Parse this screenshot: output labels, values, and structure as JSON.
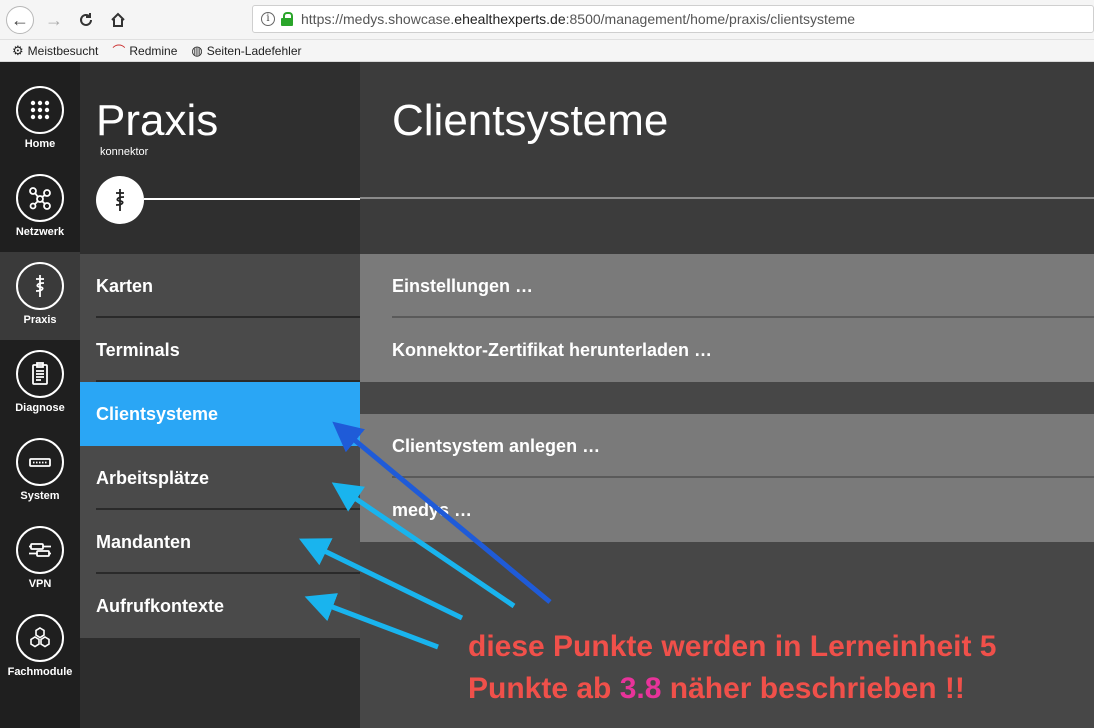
{
  "browser": {
    "url_prefix": "https://medys.showcase.",
    "url_domain": "ehealthexperts.de",
    "url_suffix": ":8500/management/home/praxis/clientsysteme",
    "bookmarks": [
      "Meistbesucht",
      "Redmine",
      "Seiten-Ladefehler"
    ]
  },
  "left_nav": {
    "items": [
      {
        "label": "Home",
        "icon": "grid-icon"
      },
      {
        "label": "Netzwerk",
        "icon": "network-icon"
      },
      {
        "label": "Praxis",
        "icon": "caduceus-icon"
      },
      {
        "label": "Diagnose",
        "icon": "clipboard-icon"
      },
      {
        "label": "System",
        "icon": "device-icon"
      },
      {
        "label": "VPN",
        "icon": "vpn-icon"
      },
      {
        "label": "Fachmodule",
        "icon": "hexagons-icon"
      }
    ],
    "active": "Praxis"
  },
  "sub_panel": {
    "title": "Praxis",
    "subtitle": "konnektor",
    "menu": [
      "Karten",
      "Terminals",
      "Clientsysteme",
      "Arbeitsplätze",
      "Mandanten",
      "Aufrufkontexte"
    ],
    "active": "Clientsysteme"
  },
  "main": {
    "title": "Clientsysteme",
    "actions": [
      "Einstellungen …",
      "Konnektor-Zertifikat herunterladen …"
    ],
    "items": [
      "Clientsystem anlegen …",
      "medys …"
    ]
  },
  "annotation": {
    "line1": "diese Punkte werden in Lerneinheit 5",
    "line2_prefix": "Punkte ab ",
    "line2_number": "3.8",
    "line2_suffix": " näher beschrieben !!"
  },
  "colors": {
    "accent": "#2aa6f5",
    "annotation_text": "#f0504a",
    "annotation_number": "#e8339a",
    "arrow_dark": "#1f5bd8",
    "arrow_light": "#19b4ee"
  }
}
